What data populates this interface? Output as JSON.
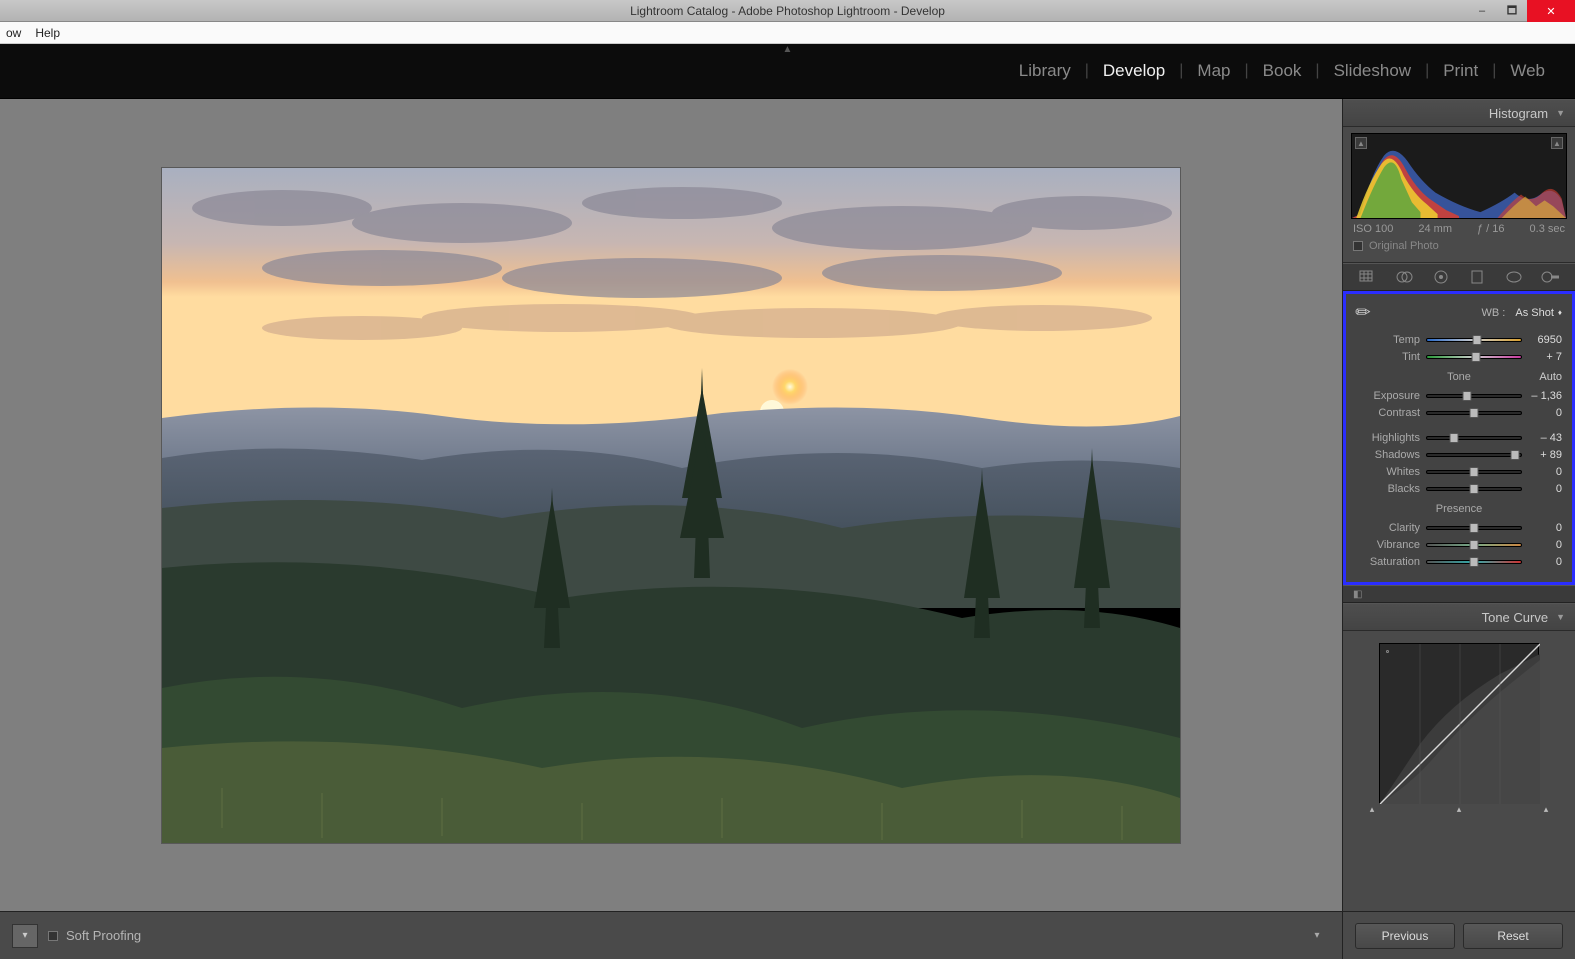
{
  "title": "Lightroom Catalog - Adobe Photoshop Lightroom - Develop",
  "menu": {
    "item0": "ow",
    "item1": "Help"
  },
  "modules": {
    "library": "Library",
    "develop": "Develop",
    "map": "Map",
    "book": "Book",
    "slideshow": "Slideshow",
    "print": "Print",
    "web": "Web"
  },
  "panels": {
    "histogram": {
      "title": "Histogram",
      "iso": "ISO 100",
      "focal": "24 mm",
      "aperture": "ƒ / 16",
      "shutter": "0.3 sec",
      "original": "Original Photo"
    },
    "basic": {
      "wb_label": "WB :",
      "wb_value": "As Shot",
      "temp_label": "Temp",
      "temp_value": "6950",
      "tint_label": "Tint",
      "tint_value": "+ 7",
      "tone_label": "Tone",
      "auto_label": "Auto",
      "exposure_label": "Exposure",
      "exposure_value": "– 1,36",
      "contrast_label": "Contrast",
      "contrast_value": "0",
      "highlights_label": "Highlights",
      "highlights_value": "– 43",
      "shadows_label": "Shadows",
      "shadows_value": "+ 89",
      "whites_label": "Whites",
      "whites_value": "0",
      "blacks_label": "Blacks",
      "blacks_value": "0",
      "presence_label": "Presence",
      "clarity_label": "Clarity",
      "clarity_value": "0",
      "vibrance_label": "Vibrance",
      "vibrance_value": "0",
      "saturation_label": "Saturation",
      "saturation_value": "0"
    },
    "tonecurve": {
      "title": "Tone Curve"
    }
  },
  "toolbar": {
    "softproof": "Soft Proofing",
    "previous": "Previous",
    "reset": "Reset"
  },
  "slider_pos": {
    "temp": 53,
    "tint": 52,
    "exposure": 43,
    "contrast": 50,
    "highlights": 29,
    "shadows": 94,
    "whites": 50,
    "blacks": 50,
    "clarity": 50,
    "vibrance": 50,
    "saturation": 50
  }
}
